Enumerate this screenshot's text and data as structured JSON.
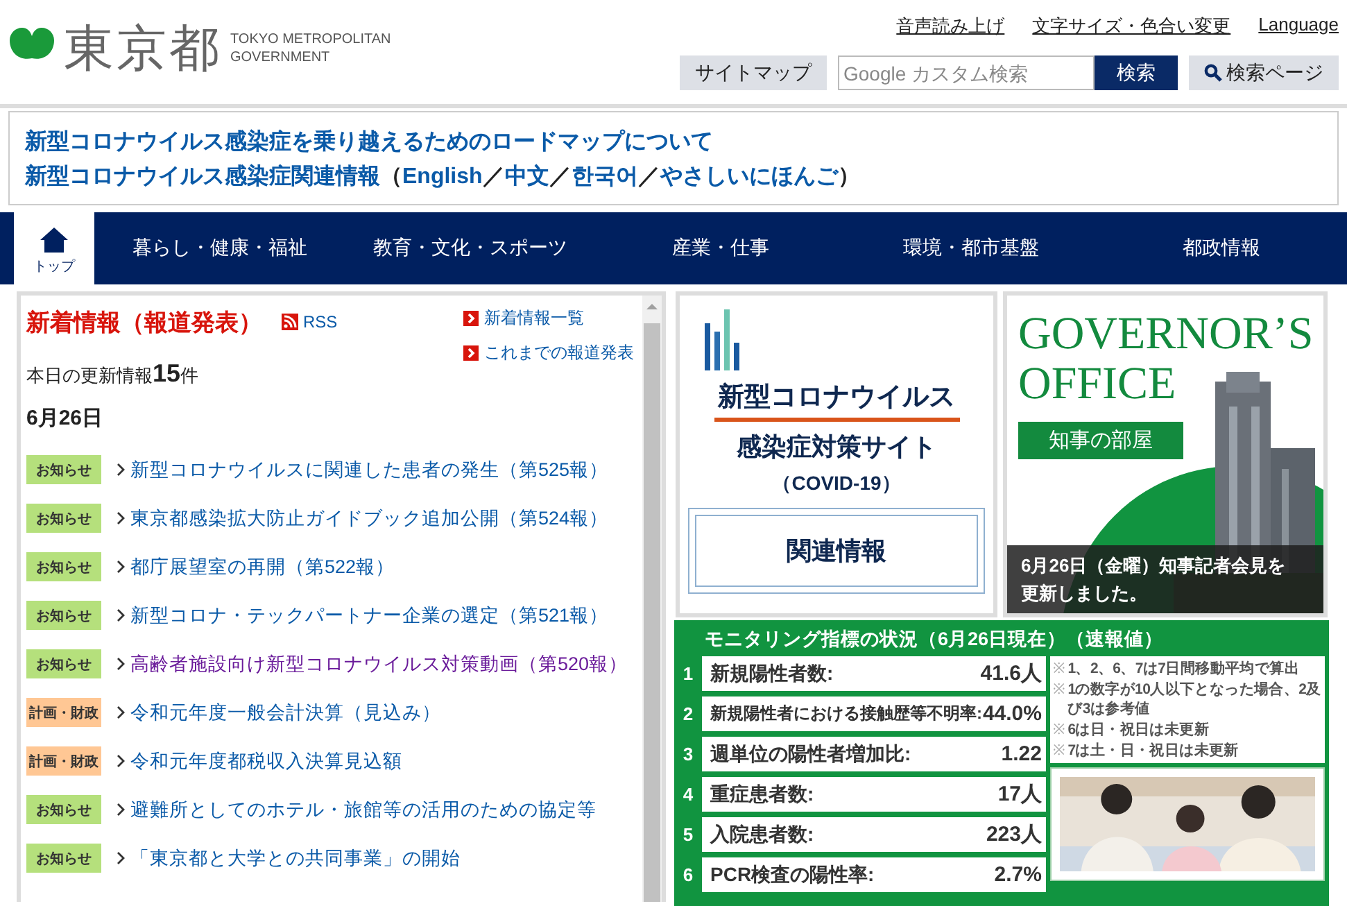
{
  "header": {
    "logo_name": "東京都",
    "logo_sub": [
      "TOKYO METROPOLITAN",
      "GOVERNMENT"
    ],
    "utility_links": [
      "音声読み上げ",
      "文字サイズ・色合い変更",
      "Language"
    ],
    "sitemap_button": "サイトマップ",
    "search": {
      "placeholder": "Google カスタム検索"
    },
    "search_button": "検索",
    "search_page_button": "検索ページ"
  },
  "notice": {
    "line_1": "新型コロナウイルス感染症を乗り越えるためのロードマップについて",
    "line_2": [
      {
        "text": "新型コロナウイルス感染症関連情報",
        "kind": "link"
      },
      {
        "text": "（",
        "kind": "punct"
      },
      {
        "text": "English",
        "kind": "link"
      },
      {
        "text": "／",
        "kind": "punct"
      },
      {
        "text": "中文",
        "kind": "link"
      },
      {
        "text": "／",
        "kind": "punct"
      },
      {
        "text": "한국어",
        "kind": "link"
      },
      {
        "text": "／",
        "kind": "punct"
      },
      {
        "text": "やさしいにほんご",
        "kind": "link"
      },
      {
        "text": "）",
        "kind": "punct"
      }
    ]
  },
  "nav": [
    {
      "label": "トップ",
      "kind": "home",
      "selected": true
    },
    {
      "label": "暮らし・健康・福祉",
      "kind": "text",
      "selected": false
    },
    {
      "label": "教育・文化・スポーツ",
      "kind": "text",
      "selected": false
    },
    {
      "label": "産業・仕事",
      "kind": "text",
      "selected": false
    },
    {
      "label": "環境・都市基盤",
      "kind": "text",
      "selected": false
    },
    {
      "label": "都政情報",
      "kind": "text",
      "selected": false
    }
  ],
  "news": {
    "title": "新着情報（報道発表）",
    "rss": "RSS",
    "links": [
      "新着情報一覧",
      "これまでの報道発表"
    ],
    "today_label": "本日の更新情報",
    "today_count": "15",
    "today_unit": "件",
    "date": "6月26日",
    "items": [
      {
        "tag": "お知らせ",
        "kind": "notice",
        "text": "新型コロナウイルスに関連した患者の発生（第525報）",
        "visited": false
      },
      {
        "tag": "お知らせ",
        "kind": "notice",
        "text": "東京都感染拡大防止ガイドブック追加公開（第524報）",
        "visited": false
      },
      {
        "tag": "お知らせ",
        "kind": "notice",
        "text": "都庁展望室の再開（第522報）",
        "visited": false
      },
      {
        "tag": "お知らせ",
        "kind": "notice",
        "text": "新型コロナ・テックパートナー企業の選定（第521報）",
        "visited": false
      },
      {
        "tag": "お知らせ",
        "kind": "notice",
        "text": "高齢者施設向け新型コロナウイルス対策動画（第520報）",
        "visited": true
      },
      {
        "tag": "計画・財政",
        "kind": "finance",
        "text": "令和元年度一般会計決算（見込み）",
        "visited": false
      },
      {
        "tag": "計画・財政",
        "kind": "finance",
        "text": "令和元年度都税収入決算見込額",
        "visited": false
      },
      {
        "tag": "お知らせ",
        "kind": "notice",
        "text": "避難所としてのホテル・旅館等の活用のための協定等",
        "visited": false
      },
      {
        "tag": "お知らせ",
        "kind": "notice",
        "text": "「東京都と大学との共同事業」の開始",
        "visited": false
      }
    ]
  },
  "covid_banner": {
    "title": "新型コロナウイルス",
    "subtitle": "感染症対策サイト",
    "note": "（COVID-19）",
    "button": "関連情報"
  },
  "governor_banner": {
    "title_1": "GOVERNOR’S",
    "title_2": "OFFICE",
    "badge": "知事の部屋",
    "caption": "6月26日（金曜）知事記者会見を更新しました。"
  },
  "monitoring": {
    "title": "モニタリング指標の状況（6月26日現在）（速報値）",
    "rows": [
      {
        "number": "1",
        "label": "新規陽性者数:",
        "value": "41.6人"
      },
      {
        "number": "2",
        "label": "新規陽性者における接触歴等不明率:",
        "value": "44.0%"
      },
      {
        "number": "3",
        "label": "週単位の陽性者増加比:",
        "value": "1.22"
      },
      {
        "number": "4",
        "label": "重症患者数:",
        "value": "17人"
      },
      {
        "number": "5",
        "label": "入院患者数:",
        "value": "223人"
      },
      {
        "number": "6",
        "label": "PCR検査の陽性率:",
        "value": "2.7%"
      }
    ],
    "notes": [
      {
        "mark": "※",
        "text": "1、2、6、7は7日間移動平均で算出"
      },
      {
        "mark": "※",
        "text": "1の数字が10人以下となった場合、2及び3は参考値"
      },
      {
        "mark": "※",
        "text": "6は日・祝日は未更新"
      },
      {
        "mark": "※",
        "text": "7は土・日・祝日は未更新"
      }
    ]
  }
}
